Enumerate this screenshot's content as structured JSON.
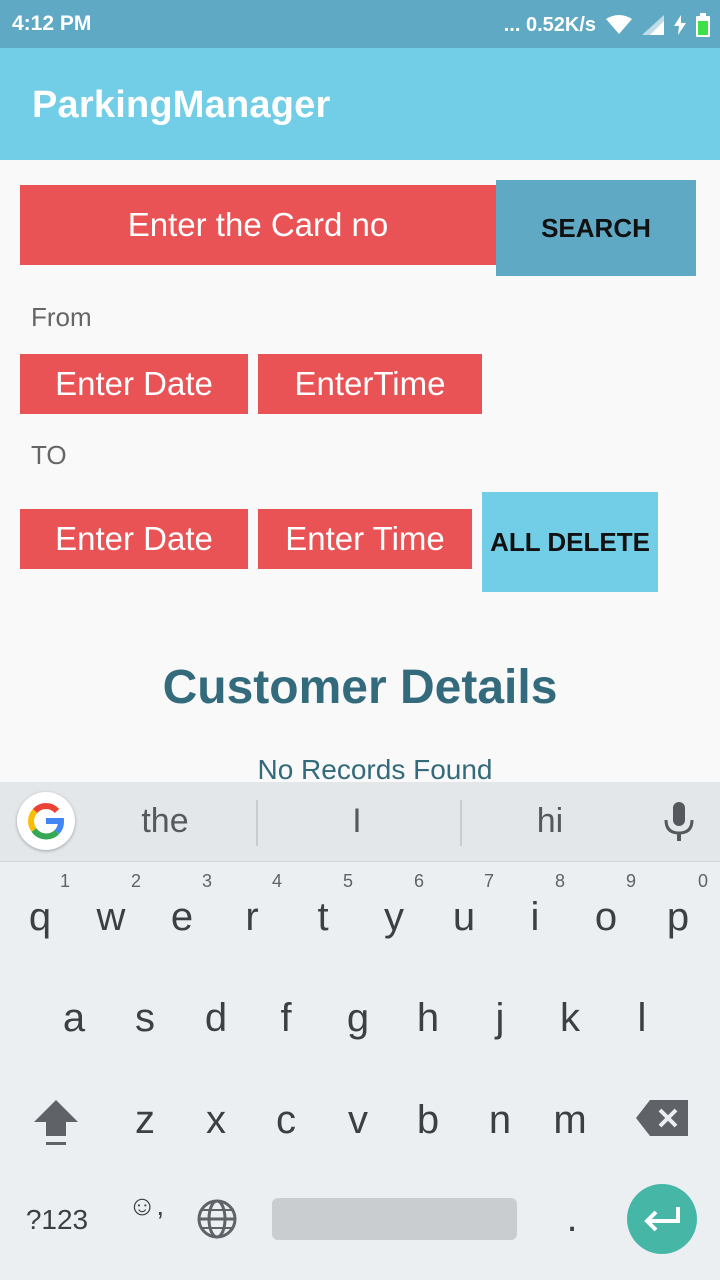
{
  "status_bar": {
    "time": "4:12 PM",
    "network_speed": "... 0.52K/s",
    "icons": [
      "wifi-icon",
      "signal-icon",
      "charging-icon",
      "battery-icon"
    ]
  },
  "app_bar": {
    "title": "ParkingManager"
  },
  "form": {
    "card_placeholder": "Enter the Card no",
    "search_label": "SEARCH",
    "from_label": "From",
    "from_date": "Enter Date",
    "from_time": "EnterTime",
    "to_label": "TO",
    "to_date": "Enter Date",
    "to_time": "Enter Time",
    "delete_label": "ALL DELETE"
  },
  "results": {
    "title": "Customer Details",
    "empty_message": "No Records Found"
  },
  "keyboard": {
    "suggestions": [
      "the",
      "I",
      "hi"
    ],
    "row1": [
      "q",
      "w",
      "e",
      "r",
      "t",
      "y",
      "u",
      "i",
      "o",
      "p"
    ],
    "row1_hints": [
      "1",
      "2",
      "3",
      "4",
      "5",
      "6",
      "7",
      "8",
      "9",
      "0"
    ],
    "row2": [
      "a",
      "s",
      "d",
      "f",
      "g",
      "h",
      "j",
      "k",
      "l"
    ],
    "row3": [
      "z",
      "x",
      "c",
      "v",
      "b",
      "n",
      "m"
    ],
    "symbols_label": "?123",
    "emoji_label": "☺,",
    "period_label": ".",
    "colors": {
      "accent": "#72cde6",
      "field_red": "#e95356",
      "enter_teal": "#46b7a7"
    }
  }
}
